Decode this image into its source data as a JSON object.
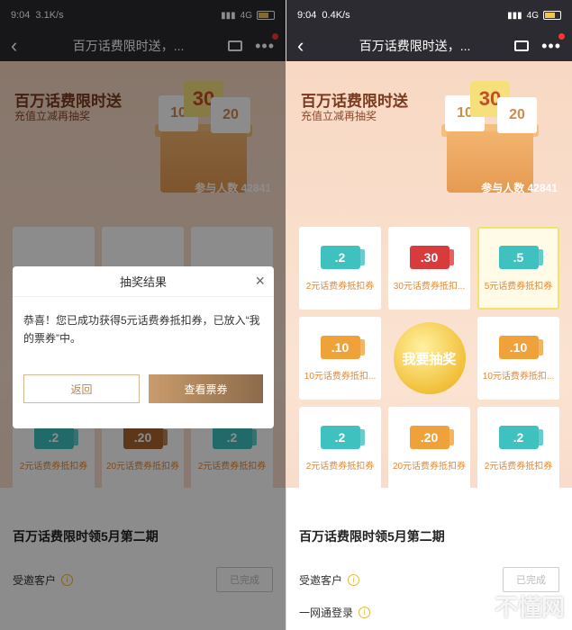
{
  "colors": {
    "teal": "#3fc1c0",
    "red": "#d83b3b",
    "orange": "#f0a23a",
    "brown": "#a8652f",
    "accent": "#f2c03a"
  },
  "left": {
    "status": {
      "time": "9:04",
      "speed": "3.1K/s",
      "network": "4G"
    },
    "nav": {
      "title": "百万话费限时送，..."
    },
    "banner": {
      "title": "百万话费限时送",
      "subtitle": "充值立减再抽奖",
      "count": "参与人数 42841"
    },
    "grid_bottom": [
      {
        "value": ".2",
        "label": "2元话费券抵扣券"
      },
      {
        "value": ".20",
        "label": "20元话费券抵扣券"
      },
      {
        "value": ".2",
        "label": "2元话费券抵扣券"
      }
    ],
    "section": {
      "title": "百万话费限时领5月第二期",
      "task1": "受邀客户",
      "task1_btn": "已完成"
    },
    "dialog": {
      "title": "抽奖结果",
      "message": "恭喜！您已成功获得5元话费券抵扣券，已放入“我的票券”中。",
      "back": "返回",
      "view": "查看票券"
    }
  },
  "right": {
    "status": {
      "time": "9:04",
      "speed": "0.4K/s",
      "network": "4G"
    },
    "nav": {
      "title": "百万话费限时送，..."
    },
    "banner": {
      "title": "百万话费限时送",
      "subtitle": "充值立减再抽奖",
      "count": "参与人数 42841"
    },
    "grid": [
      {
        "value": ".2",
        "label": "2元话费券抵扣券",
        "color": "teal"
      },
      {
        "value": ".30",
        "label": "30元话费券抵扣...",
        "color": "red"
      },
      {
        "value": ".5",
        "label": "5元话费券抵扣券",
        "color": "teal",
        "active": true
      },
      {
        "value": ".10",
        "label": "10元话费券抵扣...",
        "color": "orange"
      },
      {
        "draw": "我要抽奖"
      },
      {
        "value": ".10",
        "label": "10元话费券抵扣...",
        "color": "orange"
      },
      {
        "value": ".2",
        "label": "2元话费券抵扣券",
        "color": "teal"
      },
      {
        "value": ".20",
        "label": "20元话费券抵扣券",
        "color": "orange"
      },
      {
        "value": ".2",
        "label": "2元话费券抵扣券",
        "color": "teal"
      }
    ],
    "section": {
      "title": "百万话费限时领5月第二期",
      "task1": "受邀客户",
      "task1_btn": "已完成",
      "task2": "一网通登录"
    },
    "watermark": "不懂网"
  }
}
